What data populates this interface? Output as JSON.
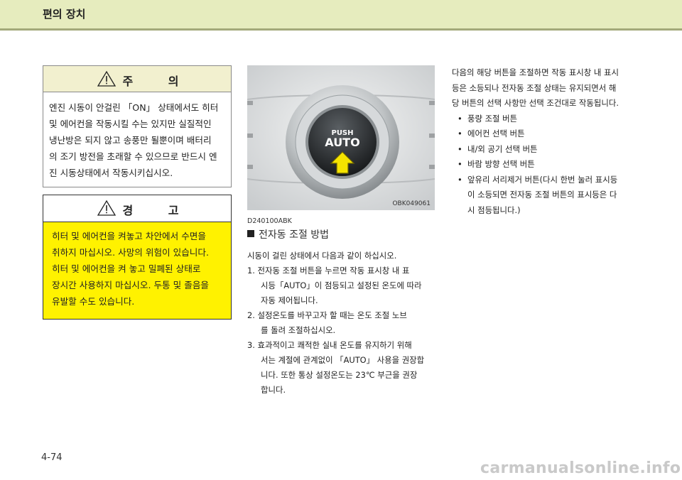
{
  "header": {
    "title": "편의 장치"
  },
  "caution": {
    "title": "주 의",
    "lines": [
      "엔진 시동이 안걸린 「ON」 상태에서도 히터",
      "및 에어컨을 작동시킬 수는 있지만 실질적인",
      "냉난방은 되지 않고 송풍만 될뿐이며 배터리",
      "의 조기 방전을 초래할 수 있으므로 반드시 엔",
      "진 시동상태에서 작동시키십시오."
    ]
  },
  "warning": {
    "title": "경 고",
    "lines": [
      "히터 및 에어컨을 켜놓고 차안에서 수면을",
      "취하지 마십시오. 사망의 위험이 있습니다.",
      "히터 및 에어컨을 켜 놓고 밀폐된 상태로",
      "장시간 사용하지 마십시오. 두통 및 졸음을",
      "유발할 수도 있습니다."
    ]
  },
  "photo": {
    "button_top": "PUSH",
    "button_main": "AUTO",
    "code": "OBK049061"
  },
  "section": {
    "ref_code": "D240100ABK",
    "title": "전자동 조절 방법",
    "intro": "시동이 걸린 상태에서 다음과 같이 하십시오.",
    "steps": [
      "1. 전자동 조절 버튼을 누르면 작동 표시창 내 표",
      "시등「AUTO」이 점등되고 설정된 온도에 따라",
      "자동 제어됩니다.",
      "2. 설정온도를 바꾸고자 할 때는 온도 조절 노브",
      "를 돌려 조절하십시오.",
      "3. 효과적이고 쾌적한 실내 온도를 유지하기 위해",
      "서는 계절에 관계없이 「AUTO」 사용을 권장합",
      "니다. 또한 통상 설정온도는 23℃ 부근을 권장",
      "합니다."
    ]
  },
  "right_column": {
    "intro": [
      "다음의 해당 버튼을 조절하면 작동 표시창 내 표시",
      "등은 소등되나 전자동 조절 상태는 유지되면서 해",
      "당 버튼의 선택 사항만 선택 조건대로 작동됩니다."
    ],
    "bullets": [
      "풍량 조절 버튼",
      "에어컨 선택 버튼",
      "내/외 공기 선택 버튼",
      "바람 방향 선택 버튼",
      "앞유리 서리제거 버튼(다시 한번 눌러 표시등",
      "이 소등되면 전자동 조절 버튼의 표시등은 다",
      "시 점등됩니다.)"
    ]
  },
  "page_number": "4-74",
  "watermark": "carmanualsonline.info"
}
